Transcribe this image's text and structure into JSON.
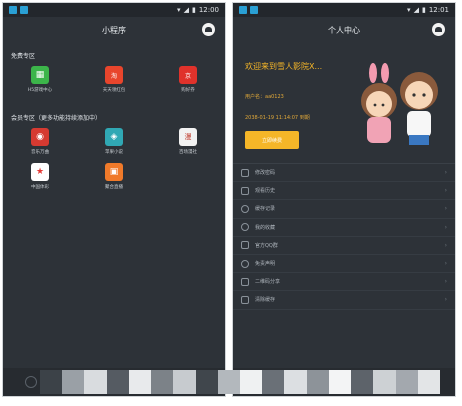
{
  "left": {
    "status": {
      "time": "12:00"
    },
    "title": "小程序",
    "free_section": "免费专区",
    "free_apps": [
      {
        "label": "H5游戏中心",
        "icon": "gamepad-icon",
        "color": "#3cb54a",
        "glyph": "🎮"
      },
      {
        "label": "天天领红包",
        "icon": "taobao-icon",
        "color": "#e8452c",
        "glyph": "淘"
      },
      {
        "label": "购好券",
        "icon": "jd-icon",
        "color": "#e0322b",
        "glyph": "京"
      }
    ],
    "member_section": "会员专区（更多功能持续添加中）",
    "member_apps": [
      {
        "label": "音乐万曲",
        "icon": "glasses-icon",
        "color": "#d63a31",
        "glyph": "◉"
      },
      {
        "label": "苹果小说",
        "icon": "game-controller-icon",
        "color": "#30a8b4",
        "glyph": "◈"
      },
      {
        "label": "百场漫社",
        "icon": "manga-icon",
        "color": "#f2f2f2",
        "glyph": "漫"
      },
      {
        "label": "中国体彩",
        "icon": "star-icon",
        "color": "#e53935",
        "glyph": "★"
      },
      {
        "label": "聚合直播",
        "icon": "tv-icon",
        "color": "#f07a2a",
        "glyph": "▣"
      }
    ]
  },
  "right": {
    "status": {
      "time": "12:01"
    },
    "title": "个人中心",
    "welcome": "欢迎来到雪人影院X...",
    "username": "用户名：aa0123",
    "expiry": "2038-01-19 11:14:07 到期",
    "renew": "立即续费",
    "menu": [
      {
        "label": "修改密码",
        "icon": "lock-icon"
      },
      {
        "label": "观看历史",
        "icon": "history-icon"
      },
      {
        "label": "缓存记录",
        "icon": "clock-icon"
      },
      {
        "label": "我的收藏",
        "icon": "heart-icon"
      },
      {
        "label": "官方QQ群",
        "icon": "document-icon"
      },
      {
        "label": "免责声明",
        "icon": "shield-icon"
      },
      {
        "label": "二维码分享",
        "icon": "qr-icon"
      },
      {
        "label": "清除缓存",
        "icon": "trash-icon"
      }
    ]
  }
}
